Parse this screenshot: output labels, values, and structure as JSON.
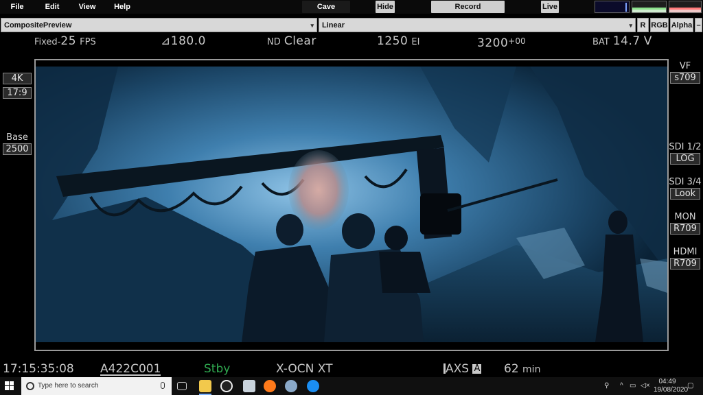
{
  "menu": {
    "file": "File",
    "edit": "Edit",
    "view": "View",
    "help": "Help"
  },
  "toolbar": {
    "cave": "Cave",
    "hide": "Hide",
    "record": "Record",
    "live": "Live"
  },
  "controls": {
    "composite_select": "CompositePreview",
    "lut_select": "Linear",
    "btn_r": "R",
    "btn_rgb": "RGB",
    "btn_alpha": "Alpha",
    "btn_minus": "–"
  },
  "camera_status": {
    "fps_prefix": "Fixed-",
    "fps_value": "25",
    "fps_unit": "FPS",
    "shutter": "180.0",
    "nd_prefix": "ND",
    "nd_value": "Clear",
    "ei_value": "1250",
    "ei_unit": "EI",
    "wb_value": "3200",
    "wb_tint": "+00",
    "bat_label": "BAT",
    "bat_value": "14.7",
    "bat_unit": "V"
  },
  "left_panel": {
    "resolution": "4K",
    "aspect": "17:9",
    "base_label": "Base",
    "base_value": "2500"
  },
  "right_panel": {
    "vf_label": "VF",
    "vf_value": "s709",
    "sdi12_label": "SDI 1/2",
    "sdi12_value": "LOG",
    "sdi34_label": "SDI 3/4",
    "sdi34_value": "Look",
    "mon_label": "MON",
    "mon_value": "R709",
    "hdmi_label": "HDMI",
    "hdmi_value": "R709"
  },
  "bottom_status": {
    "timecode": "17:15:35:08",
    "clip": "A422C001",
    "state": "Stby",
    "codec": "X-OCN XT",
    "media": "AXS",
    "media_slot": "A",
    "remaining": "62",
    "remaining_unit": "min"
  },
  "taskbar": {
    "search_placeholder": "Type here to search",
    "time": "04:49",
    "date": "19/08/2020"
  },
  "colors": {
    "state_green": "#2fa84f",
    "scene_blue": "#2d6a95"
  }
}
